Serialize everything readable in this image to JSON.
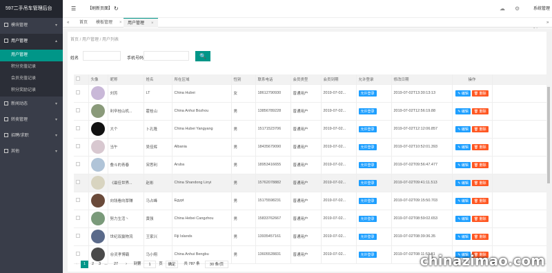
{
  "sidebar": {
    "brand": "597二手吊车管理后台",
    "menus": [
      {
        "label": "模块管理",
        "arrow": "▾"
      },
      {
        "label": "用户管理",
        "arrow": "▴"
      },
      {
        "label": "新闻动态",
        "arrow": "▾"
      },
      {
        "label": "转卖管理",
        "arrow": "▾"
      },
      {
        "label": "招聘/求职",
        "arrow": "▾"
      },
      {
        "label": "其他",
        "arrow": "▾"
      }
    ],
    "sub_items": [
      "用户管理",
      "积分充值记录",
      "会员充值记录",
      "积分奖励记录"
    ]
  },
  "topbar": {
    "menu_icon": "☰",
    "refresh_label": "【刷新页面】",
    "refresh_icon": "↻",
    "cloud_icon": "☁",
    "settings_icon": "⚙",
    "system_label": "系统管理员"
  },
  "tabs": {
    "left_arrow": "«",
    "right_arrow": "»",
    "items": [
      "首页",
      "模板管理",
      "用户管理"
    ],
    "close": "×"
  },
  "breadcrumb": "首页 / 用户管理 / 用户列表",
  "search": {
    "name_label": "姓名",
    "phone_label": "手机号码",
    "button_icon": "🔍"
  },
  "table": {
    "headers": [
      "",
      "头像",
      "昵称",
      "姓名",
      "所在区域",
      "性别",
      "联系电话",
      "会员类型",
      "会员到期",
      "允许登录",
      "修改日期",
      "操作"
    ],
    "rows": [
      {
        "nick": "刘芳",
        "name": "LT",
        "area": "China Hubei",
        "sex": "女",
        "phone": "18612790930",
        "type": "普通用户",
        "expire": "2019-07-02...",
        "login": "允许登录",
        "date": "2019-07-02T13:30:13:13",
        "avatar": "#c9b8d8"
      },
      {
        "nick": "利辛桂山机...",
        "name": "霍桂山",
        "area": "China Anhui Bozhou",
        "sex": "男",
        "phone": "13856789228",
        "type": "普通用户",
        "expire": "2019-07-02...",
        "login": "允许登录",
        "date": "2019-07-02T12:56:19.88",
        "avatar": "#8a9a7a"
      },
      {
        "nick": "大个",
        "name": "卜孔隆",
        "area": "China Hubei Yangyang",
        "sex": "男",
        "phone": "15171523706",
        "type": "普通用户",
        "expire": "2019-07-02...",
        "login": "允许登录",
        "date": "2019-07-02T12:12:06.857",
        "avatar": "#111111"
      },
      {
        "nick": "当午",
        "name": "吴佳辉",
        "area": "Albania",
        "sex": "男",
        "phone": "18435679090",
        "type": "普通用户",
        "expire": "2019-07-02...",
        "login": "允许登录",
        "date": "2019-07-02T10:52:01.393",
        "avatar": "#d8c8d0"
      },
      {
        "nick": "叠斗的青春",
        "name": "宋思利",
        "area": "Aruba",
        "sex": "男",
        "phone": "18953416655",
        "type": "普通用户",
        "expire": "2019-07-02...",
        "login": "允许登录",
        "date": "2019-07-02T09:56:47.477",
        "avatar": "#b0c4d8"
      },
      {
        "nick": "《最佳世界...",
        "name": "赵彬",
        "area": "China Shandong Linyi",
        "sex": "男",
        "phone": "15762078882",
        "type": "普通用户",
        "expire": "2019-07-02...",
        "login": "允许登录",
        "date": "2019-07-02T09:41:11.513",
        "avatar": "#d8d4c0"
      },
      {
        "nick": "向钱看向厚赚",
        "name": "马占峰",
        "area": "Egypt",
        "sex": "男",
        "phone": "15175598231",
        "type": "普通用户",
        "expire": "2019-07-02...",
        "login": "允许登录",
        "date": "2019-07-02T09:15:50.703",
        "avatar": "#6a4a3a"
      },
      {
        "nick": "努力生活丶",
        "name": "黄强",
        "area": "China Hebei Cangzhou",
        "sex": "男",
        "phone": "15833762667",
        "type": "普通用户",
        "expire": "2019-07-02...",
        "login": "允许登录",
        "date": "2019-07-02T08:59:02.653",
        "avatar": "#7a9a7a"
      },
      {
        "nick": "世纪双赢物流",
        "name": "王家兴",
        "area": "Fiji Islands",
        "sex": "男",
        "phone": "13935457161",
        "type": "普通用户",
        "expire": "2019-07-02...",
        "login": "允许登录",
        "date": "2019-07-02T08:39:36.35",
        "avatar": "#5a6a8a"
      },
      {
        "nick": "😵灵孝博霸",
        "name": "马小翔",
        "area": "China Anhui Bengbu",
        "sex": "男",
        "phone": "13605528831",
        "type": "普通用户",
        "expire": "2019-07-02...",
        "login": "允许登录",
        "date": "2019-07-02T08:11:53.81",
        "avatar": "#4a4a4a"
      }
    ],
    "edit_label": "✎ 编辑",
    "delete_label": "🗑 删除"
  },
  "pager": {
    "prev": "‹",
    "pages": [
      "1",
      "2",
      "3",
      "...",
      "27"
    ],
    "next": "›",
    "goto_label": "到第",
    "goto_value": "1",
    "page_unit": "页",
    "confirm": "确定",
    "total": "共 787 条",
    "per_page": "30 条/页"
  },
  "watermark": "chinazimao.com"
}
